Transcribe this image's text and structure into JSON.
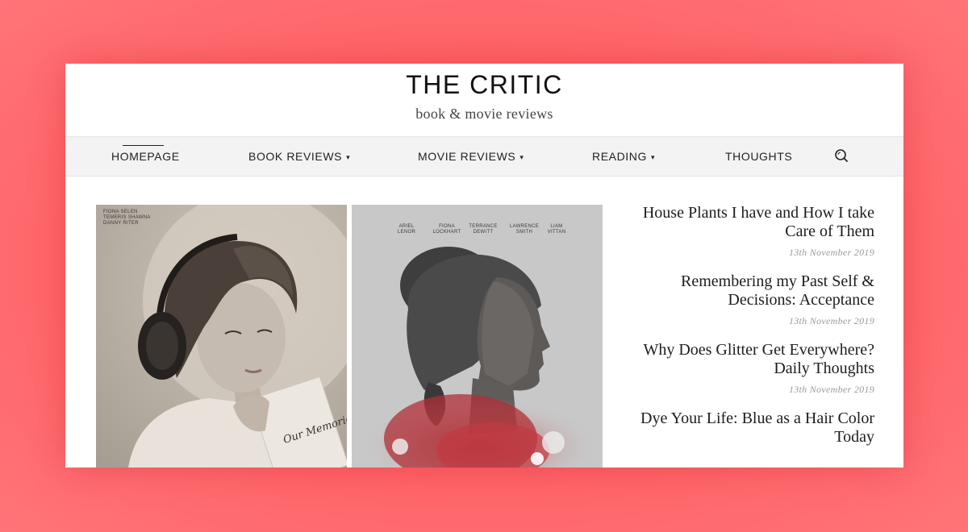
{
  "site": {
    "title": "THE CRITIC",
    "tagline": "book & movie reviews"
  },
  "nav": {
    "items": [
      {
        "label": "HOMEPAGE"
      },
      {
        "label": "BOOK REVIEWS"
      },
      {
        "label": "MOVIE REVIEWS"
      },
      {
        "label": "READING"
      },
      {
        "label": "THOUGHTS"
      }
    ],
    "caret": "▾",
    "search_icon": "search-icon"
  },
  "posters": [
    {
      "credits": [
        "FIONA SELEN",
        "TEMERIS SHAWNA",
        "DANNY RITER"
      ],
      "book_text": "Our Memories"
    },
    {
      "credits": [
        {
          "first": "ARIEL",
          "last": "LENOR"
        },
        {
          "first": "FIONA",
          "last": "LOCKHART"
        },
        {
          "first": "TERRANCE",
          "last": "DEWITT"
        },
        {
          "first": "LAWRENCE",
          "last": "SMITH"
        },
        {
          "first": "LIAM",
          "last": "VITTAN"
        }
      ]
    }
  ],
  "sidebar": {
    "posts": [
      {
        "title": "House Plants I have and How I take Care of Them",
        "date": "13th November 2019"
      },
      {
        "title": "Remembering my Past Self & Decisions: Acceptance",
        "date": "13th November 2019"
      },
      {
        "title": "Why Does Glitter Get Everywhere? Daily Thoughts",
        "date": "13th November 2019"
      },
      {
        "title": "Dye Your Life: Blue as a Hair Color Today",
        "date": ""
      }
    ]
  },
  "colors": {
    "background": "#ff6468",
    "nav_background": "#f3f3f3",
    "accent_red": "#c0303a"
  }
}
